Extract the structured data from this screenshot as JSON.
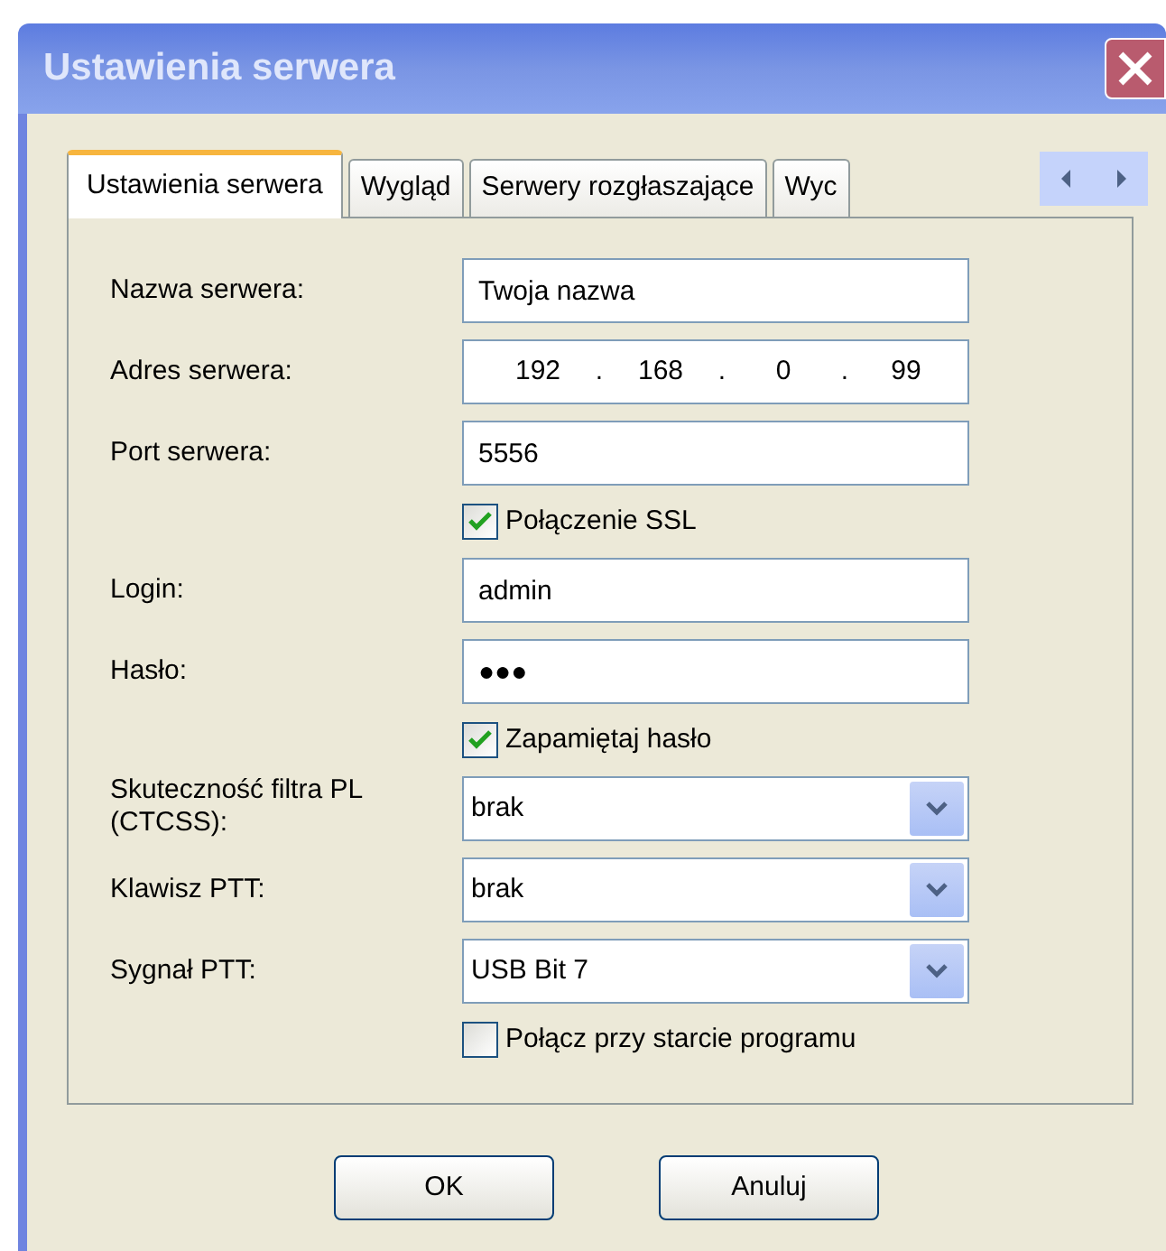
{
  "window": {
    "title": "Ustawienia serwera"
  },
  "tabs": [
    {
      "label": "Ustawienia serwera",
      "selected": true
    },
    {
      "label": "Wygląd",
      "selected": false
    },
    {
      "label": "Serwery rozgłaszające",
      "selected": false
    },
    {
      "label": "Wyc",
      "selected": false
    }
  ],
  "form": [
    {
      "kind": "text",
      "label": "Nazwa serwera:",
      "value": "Twoja nazwa"
    },
    {
      "kind": "ip",
      "label": "Adres serwera:",
      "octets": [
        "192",
        "168",
        "0",
        "99"
      ],
      "separator": "."
    },
    {
      "kind": "text",
      "label": "Port serwera:",
      "value": "5556"
    },
    {
      "kind": "checkbox",
      "label": "Połączenie SSL",
      "checked": true
    },
    {
      "kind": "text",
      "label": "Login:",
      "value": "admin"
    },
    {
      "kind": "text",
      "label": "Hasło:",
      "value": "●●●"
    },
    {
      "kind": "checkbox",
      "label": "Zapamiętaj hasło",
      "checked": true
    },
    {
      "kind": "select",
      "label": "Skuteczność filtra PL (CTCSS):",
      "value": "brak"
    },
    {
      "kind": "select",
      "label": "Klawisz PTT:",
      "value": "brak"
    },
    {
      "kind": "select",
      "label": "Sygnał PTT:",
      "value": "USB Bit 7"
    },
    {
      "kind": "checkbox",
      "label": "Połącz przy starcie programu",
      "checked": false
    }
  ],
  "buttons": [
    "OK",
    "Anuluj"
  ]
}
